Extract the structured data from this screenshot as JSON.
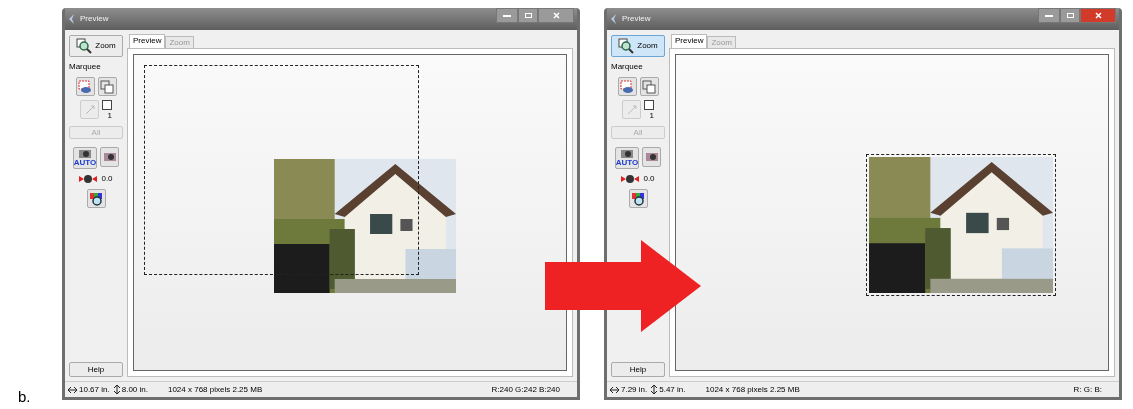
{
  "label": "b.",
  "windows": [
    {
      "title": "Preview",
      "active": false,
      "tabs": [
        {
          "label": "Preview",
          "selected": true
        },
        {
          "label": "Zoom",
          "selected": false
        }
      ],
      "zoom_button": {
        "label": "Zoom",
        "selected": false
      },
      "marquee_label": "Marquee",
      "marquee_count": "1",
      "marquee_checked": false,
      "all_button": {
        "label": "All",
        "disabled": true
      },
      "auto_badge": "AUTO",
      "exposure": "0.0",
      "help": "Help",
      "marquee": {
        "kind": "offset"
      },
      "status": {
        "width": "10.67 in.",
        "height": "8.00 in.",
        "size": "1024 x 768 pixels 2.25 MB",
        "rgb": "R:240 G:242 B:240"
      }
    },
    {
      "title": "Preview",
      "active": true,
      "tabs": [
        {
          "label": "Preview",
          "selected": true
        },
        {
          "label": "Zoom",
          "selected": false
        }
      ],
      "zoom_button": {
        "label": "Zoom",
        "selected": true
      },
      "marquee_label": "Marquee",
      "marquee_count": "1",
      "marquee_checked": false,
      "all_button": {
        "label": "All",
        "disabled": true
      },
      "auto_badge": "AUTO",
      "exposure": "0.0",
      "help": "Help",
      "marquee": {
        "kind": "fitted"
      },
      "status": {
        "width": "7.29 in.",
        "height": "5.47 in.",
        "size": "1024 x 768 pixels 2.25 MB",
        "rgb": "R: G: B:"
      }
    }
  ]
}
